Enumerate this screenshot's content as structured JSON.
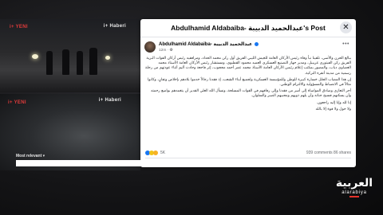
{
  "video": {
    "watermark_top_left": "i+ YENI",
    "watermark_top_right": "i+ Haberi",
    "watermark_bottom_left": "i+ YENI",
    "watermark_bottom_right": "i+ Haberi"
  },
  "post": {
    "header_title": "Abdulhamid Aldabaiba- عبدالحميد الدبيبة's Post",
    "close_icon": "close-icon",
    "author_name": "Abdulhamid Aldabaiba- عبدالحميد الدبيبة",
    "verified_icon": "verified-badge-icon",
    "timestamp": "12m",
    "privacy_icon": "globe-icon",
    "more_icon": "more-dots-icon",
    "body_paragraphs": [
      "ببالغ الحزن والأسى، تلقينا نبأ وفاة رئيس الأركان العامة للجيش الليبي الفريق أول ركن محمد الحداد، ومرافقيه رئيس أركان القوات البرية الفريق ركن الفيتوري غريبيل، ومدير جهاز التصنيع العسكري العميد محمود القطيوي، ومستشار رئيس الأركان العامة الأستاذ محمد العصاوي دياب، والمصور بمكتب إعلام رئيس الأركان العامة الأستاذ محمد عمر أحمد محجوب، إثر فاجعة وحادث أليم أثناء عودتهم من رحلة رسمية من مدينة أنقرة التركية.",
      "إن هذا المصاب الجلل خسارة كبيرة للوطن وللمؤسسة العسكرية ولجميع أبناء الشعب، إذ فقدنا رجالاً خدموا بلادهم بإخلاص وتفانٍ، وكانوا مثالاً في الانضباط والمسؤولية والالتزام الوطني.",
      "أحر التعازي وصادق المواساة إلى أسر من فقدنا وإلى رفاقهم في القوات المسلحة، ونسأل الله العلي القدير أن يتغمدهم بواسع رحمته وأن يسكنهم فسيح جناته وأن يلهم ذويهم ومحبيهم الصبر والسلوان.",
      "إنا لله وإنا إليه راجعون.",
      "ولا حول ولا قوة إلا بالله"
    ],
    "reaction_count": "5K",
    "counts_text": "939 comments  86 shares",
    "most_relevant": "Most relevant"
  },
  "logo": {
    "arabic": "العربية",
    "latin": "alarabiya"
  },
  "colors": {
    "accent": "#e4322b",
    "facebook_blue": "#1877f2"
  }
}
